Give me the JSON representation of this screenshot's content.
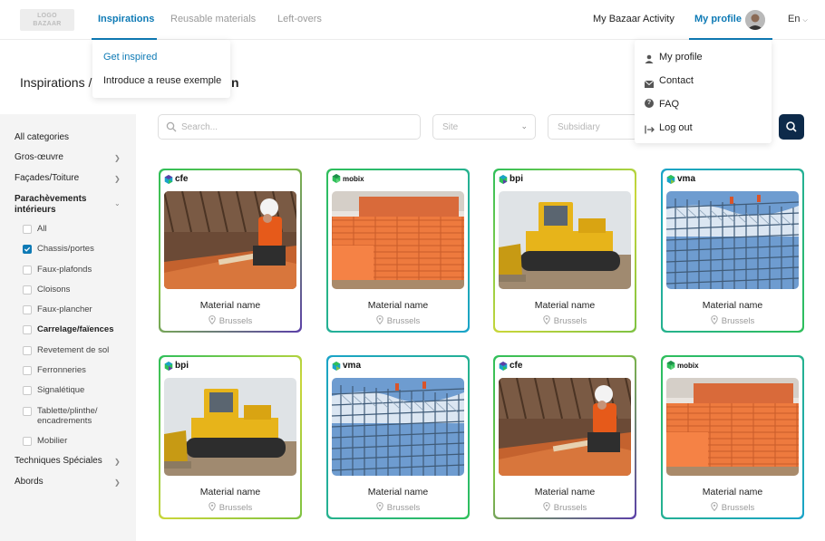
{
  "logo": {
    "line1": "LOGO",
    "line2": "BAZAAR"
  },
  "nav": {
    "inspirations": "Inspirations",
    "reusable": "Reusable materials",
    "leftovers": "Left-overs",
    "activity": "My Bazaar Activity",
    "profile": "My profile",
    "lang": "En"
  },
  "insp_menu": {
    "items": [
      "Get inspired",
      "Introduce a reuse exemple"
    ]
  },
  "profile_menu": {
    "items": [
      "My profile",
      "Contact",
      "FAQ",
      "Log out"
    ]
  },
  "breadcrumb": {
    "root": "Inspirations",
    "sep": "/",
    "tail": "n"
  },
  "sidebar": {
    "all": "All categories",
    "cats": [
      "Gros-œuvre",
      "Façades/Toiture"
    ],
    "active": "Parachèvements intérieurs",
    "subs": [
      {
        "label": "All",
        "checked": false,
        "bold": false
      },
      {
        "label": "Chassis/portes",
        "checked": true,
        "bold": false
      },
      {
        "label": "Faux-plafonds",
        "checked": false,
        "bold": false
      },
      {
        "label": "Cloisons",
        "checked": false,
        "bold": false
      },
      {
        "label": "Faux-plancher",
        "checked": false,
        "bold": false
      },
      {
        "label": "Carrelage/faïences",
        "checked": false,
        "bold": true
      },
      {
        "label": "Revetement de sol",
        "checked": false,
        "bold": false
      },
      {
        "label": "Ferronneries",
        "checked": false,
        "bold": false
      },
      {
        "label": "Signalétique",
        "checked": false,
        "bold": false
      },
      {
        "label": "Tablette/plinthe/\nencadrements",
        "checked": false,
        "bold": false
      },
      {
        "label": "Mobilier",
        "checked": false,
        "bold": false
      }
    ],
    "bottom": [
      "Techniques Spéciales",
      "Abords"
    ]
  },
  "filters": {
    "search_placeholder": "Search...",
    "site_placeholder": "Site",
    "subsidiary_placeholder": "Subsidiary"
  },
  "cards": [
    {
      "brand": "cfe",
      "img": "worker",
      "name": "Material name",
      "loc": "Brussels"
    },
    {
      "brand": "mobix",
      "img": "bricks",
      "name": "Material name",
      "loc": "Brussels"
    },
    {
      "brand": "bpi",
      "img": "bulldozer",
      "name": "Material name",
      "loc": "Brussels"
    },
    {
      "brand": "vma",
      "img": "scaffold",
      "name": "Material name",
      "loc": "Brussels"
    },
    {
      "brand": "bpi",
      "img": "bulldozer",
      "name": "Material name",
      "loc": "Brussels"
    },
    {
      "brand": "vma",
      "img": "scaffold",
      "name": "Material name",
      "loc": "Brussels"
    },
    {
      "brand": "cfe",
      "img": "worker",
      "name": "Material name",
      "loc": "Brussels"
    },
    {
      "brand": "mobix",
      "img": "bricks",
      "name": "Material name",
      "loc": "Brussels"
    }
  ],
  "colors": {
    "accent": "#0e7ab5",
    "navy": "#0d2a4a",
    "sidebar": "#f4f4f4"
  }
}
